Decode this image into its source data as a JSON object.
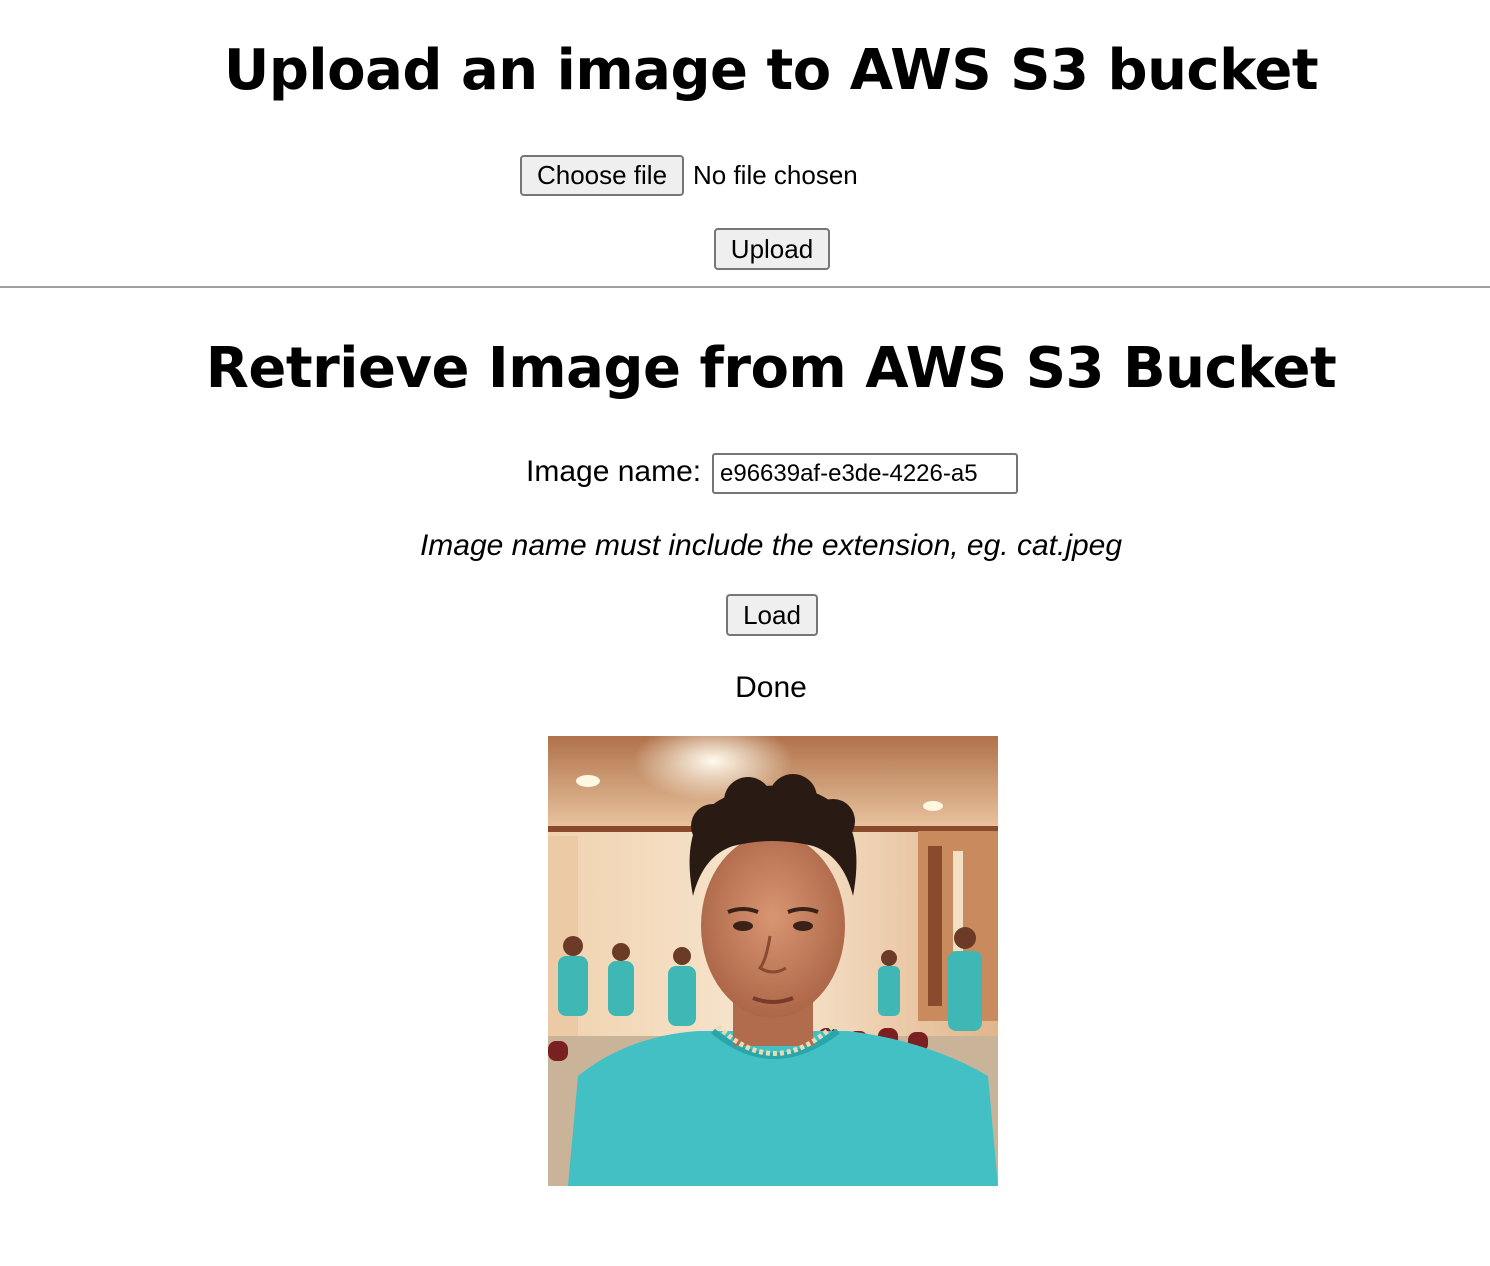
{
  "upload": {
    "title": "Upload an image to AWS S3 bucket",
    "choose_file_label": "Choose file",
    "no_file_text": "No file chosen",
    "upload_label": "Upload"
  },
  "retrieve": {
    "title": "Retrieve Image from AWS S3 Bucket",
    "image_name_label": "Image name:",
    "image_name_value": "e96639af-e3de-4226-a5",
    "hint": "Image name must include the extension, eg. cat.jpeg",
    "load_label": "Load",
    "status": "Done"
  }
}
